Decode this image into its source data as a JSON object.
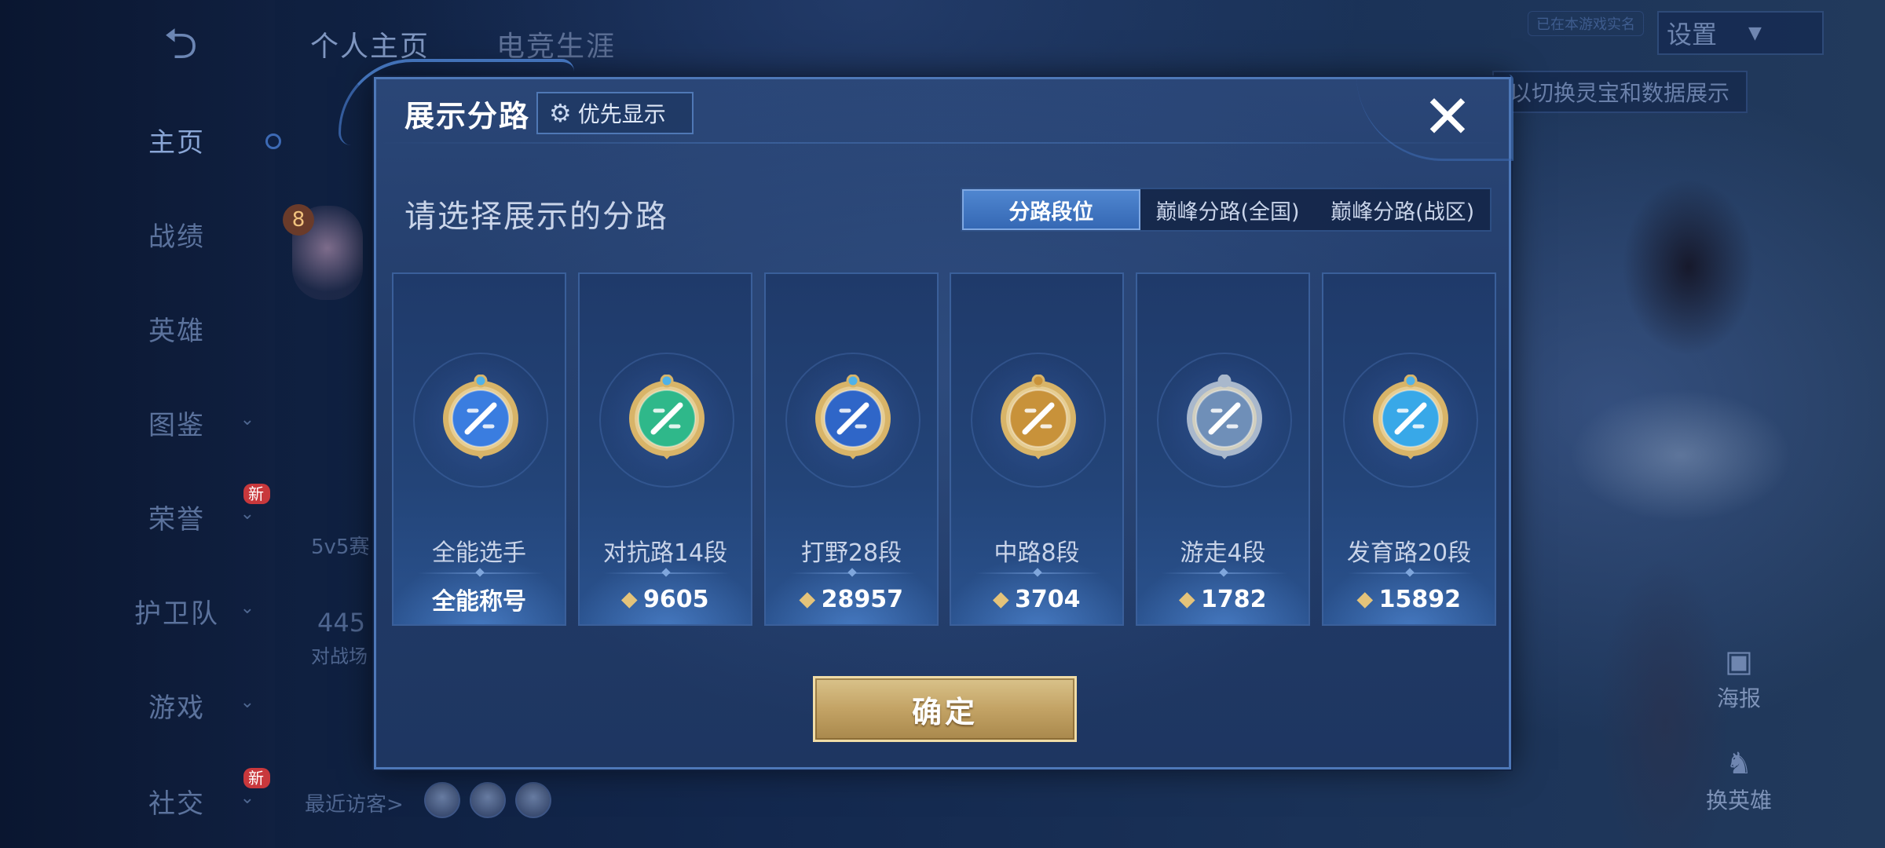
{
  "background": {
    "top_tabs": [
      "个人主页",
      "电竞生涯"
    ],
    "settings_label": "设置",
    "top_badge": "已在本游戏实名",
    "hint_text": "以切换灵宝和数据展示",
    "nav_items": [
      {
        "label": "主页",
        "active": true,
        "chevron": false,
        "new": false
      },
      {
        "label": "战绩",
        "active": false,
        "chevron": false,
        "new": false
      },
      {
        "label": "英雄",
        "active": false,
        "chevron": false,
        "new": false
      },
      {
        "label": "图鉴",
        "active": false,
        "chevron": true,
        "new": false
      },
      {
        "label": "荣誉",
        "active": false,
        "chevron": true,
        "new": true
      },
      {
        "label": "护卫队",
        "active": false,
        "chevron": true,
        "new": false
      },
      {
        "label": "游戏",
        "active": false,
        "chevron": true,
        "new": false
      },
      {
        "label": "社交",
        "active": false,
        "chevron": true,
        "new": true
      }
    ],
    "new_badge": "新",
    "rank_level": "8",
    "season_label": "5v5赛",
    "stat_value": "445",
    "stat_caption": "对战场",
    "recent_visitors_label": "最近访客>",
    "side_actions": [
      {
        "label": "海报",
        "icon": "poster-icon"
      },
      {
        "label": "换英雄",
        "icon": "switch-hero-icon"
      }
    ]
  },
  "modal": {
    "title": "展示分路",
    "priority_button": "优先显示",
    "close_icon": "close-icon",
    "subtitle": "请选择展示的分路",
    "tabs": [
      {
        "label": "分路段位",
        "active": true
      },
      {
        "label": "巅峰分路(全国)",
        "active": false
      },
      {
        "label": "巅峰分路(战区)",
        "active": false
      }
    ],
    "cards": [
      {
        "name": "全能选手",
        "value": "全能称号",
        "show_score_icon": false,
        "emblem": "all-round-emblem",
        "core_color": "#3a7de0",
        "ring_color": "#d8b468",
        "gem_color": "#4fb2e8"
      },
      {
        "name": "对抗路14段",
        "value": "9605",
        "show_score_icon": true,
        "emblem": "clash-lane-emblem",
        "core_color": "#2fb88a",
        "ring_color": "#d8b468",
        "gem_color": "#4fb2e8"
      },
      {
        "name": "打野28段",
        "value": "28957",
        "show_score_icon": true,
        "emblem": "jungle-emblem",
        "core_color": "#2f66c8",
        "ring_color": "#d8b468",
        "gem_color": "#4fb2e8"
      },
      {
        "name": "中路8段",
        "value": "3704",
        "show_score_icon": true,
        "emblem": "mid-lane-emblem",
        "core_color": "#c8923a",
        "ring_color": "#d8b468",
        "gem_color": "#c8923a"
      },
      {
        "name": "游走4段",
        "value": "1782",
        "show_score_icon": true,
        "emblem": "roam-emblem",
        "core_color": "#6f8fb8",
        "ring_color": "#a9b8cc",
        "gem_color": "#a9b8cc"
      },
      {
        "name": "发育路20段",
        "value": "15892",
        "show_score_icon": true,
        "emblem": "farm-lane-emblem",
        "core_color": "#38a8e8",
        "ring_color": "#d8b468",
        "gem_color": "#4fb2e8"
      }
    ],
    "score_icon": "score-icon",
    "confirm_button": "确定"
  }
}
